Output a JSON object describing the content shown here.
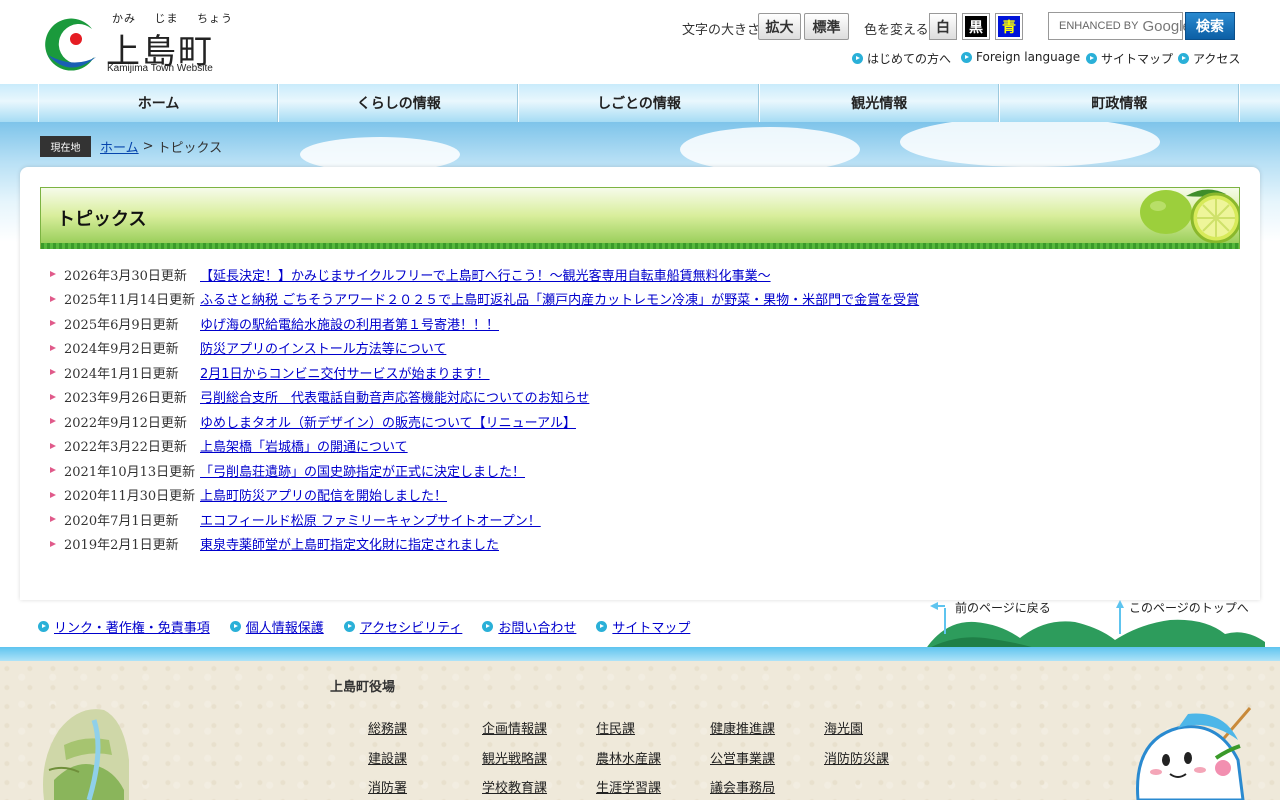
{
  "header": {
    "logo": {
      "ruby": [
        "かみ",
        "じま",
        "ちょう"
      ],
      "name": "上島町",
      "en": "Kamijima Town Website"
    },
    "font_size": {
      "label": "文字の大きさ",
      "enlarge": "拡大",
      "standard": "標準"
    },
    "color_change": {
      "label": "色を変える",
      "white": "白",
      "black": "黒",
      "blue": "青"
    },
    "search": {
      "placeholder_prefix": "ENHANCED BY",
      "placeholder_brand": "Google",
      "button": "検索"
    },
    "sublinks": [
      "はじめての方へ",
      "Foreign language",
      "サイトマップ",
      "アクセス"
    ]
  },
  "nav": [
    "ホーム",
    "くらしの情報",
    "しごとの情報",
    "観光情報",
    "町政情報"
  ],
  "breadcrumb": {
    "label": "現在地",
    "home": "ホーム",
    "separator": ">",
    "current": "トピックス"
  },
  "page_title": "トピックス",
  "topics": [
    {
      "date": "2026年3月30日更新",
      "title": "【延長決定！】かみじまサイクルフリーで上島町へ行こう！～観光客専用自転車船賃無料化事業～"
    },
    {
      "date": "2025年11月14日更新",
      "title": "ふるさと納税 ごちそうアワード２０２５で上島町返礼品「瀬戸内産カットレモン冷凍」が野菜・果物・米部門で金賞を受賞"
    },
    {
      "date": "2025年6月9日更新",
      "title": "ゆげ海の駅給電給水施設の利用者第１号寄港！！！"
    },
    {
      "date": "2024年9月2日更新",
      "title": "防災アプリのインストール方法等について"
    },
    {
      "date": "2024年1月1日更新",
      "title": "2月1日からコンビニ交付サービスが始まります！"
    },
    {
      "date": "2023年9月26日更新",
      "title": "弓削総合支所　代表電話自動音声応答機能対応についてのお知らせ"
    },
    {
      "date": "2022年9月12日更新",
      "title": "ゆめしまタオル（新デザイン）の販売について【リニューアル】"
    },
    {
      "date": "2022年3月22日更新",
      "title": "上島架橋「岩城橋」の開通について"
    },
    {
      "date": "2021年10月13日更新",
      "title": "「弓削島荘遺跡」の国史跡指定が正式に決定しました！"
    },
    {
      "date": "2020年11月30日更新",
      "title": "上島町防災アプリの配信を開始しました！"
    },
    {
      "date": "2020年7月1日更新",
      "title": "エコフィールド松原 ファミリーキャンプサイトオープン！"
    },
    {
      "date": "2019年2月1日更新",
      "title": "東泉寺薬師堂が上島町指定文化財に指定されました"
    }
  ],
  "footer_links": [
    "リンク・著作権・免責事項",
    "個人情報保護",
    "アクセシビリティ",
    "お問い合わせ",
    "サイトマップ"
  ],
  "page_nav": {
    "back": "前のページに戻る",
    "top": "このページのトップへ"
  },
  "office": {
    "name": "上島町役場",
    "departments": [
      "総務課",
      "企画情報課",
      "住民課",
      "健康推進課",
      "海光園",
      "建設課",
      "観光戦略課",
      "農林水産課",
      "公営事業課",
      "消防防災課",
      "消防署",
      "学校教育課",
      "生涯学習課",
      "議会事務局"
    ]
  },
  "colors": {
    "link": "#0000cc",
    "accent_blue": "#2ab0d8",
    "title_green": "#8dc84e"
  }
}
